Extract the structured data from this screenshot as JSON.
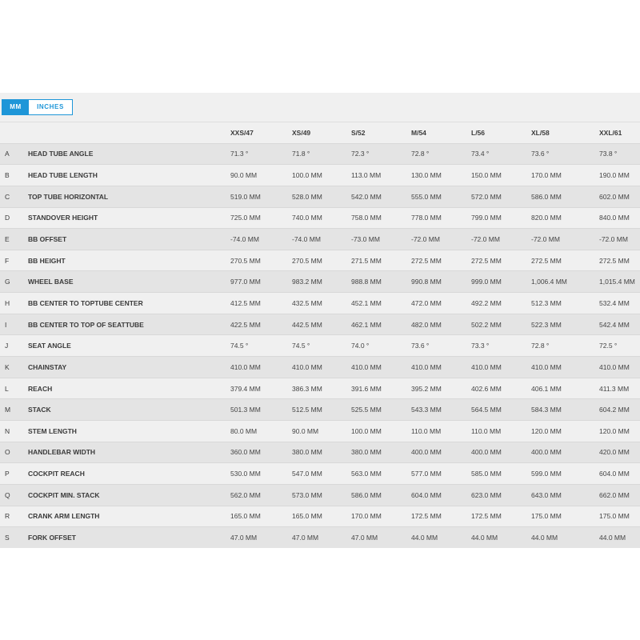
{
  "units": {
    "mm_label": "MM",
    "inches_label": "INCHES",
    "active": "mm"
  },
  "sizes": [
    "XXS/47",
    "XS/49",
    "S/52",
    "M/54",
    "L/56",
    "XL/58",
    "XXL/61"
  ],
  "rows": [
    {
      "letter": "A",
      "name": "HEAD TUBE ANGLE",
      "values": [
        "71.3 °",
        "71.8 °",
        "72.3 °",
        "72.8 °",
        "73.4 °",
        "73.6 °",
        "73.8 °"
      ]
    },
    {
      "letter": "B",
      "name": "HEAD TUBE LENGTH",
      "values": [
        "90.0 MM",
        "100.0 MM",
        "113.0 MM",
        "130.0 MM",
        "150.0 MM",
        "170.0 MM",
        "190.0 MM"
      ]
    },
    {
      "letter": "C",
      "name": "TOP TUBE HORIZONTAL",
      "values": [
        "519.0 MM",
        "528.0 MM",
        "542.0 MM",
        "555.0 MM",
        "572.0 MM",
        "586.0 MM",
        "602.0 MM"
      ]
    },
    {
      "letter": "D",
      "name": "STANDOVER HEIGHT",
      "values": [
        "725.0 MM",
        "740.0 MM",
        "758.0 MM",
        "778.0 MM",
        "799.0 MM",
        "820.0 MM",
        "840.0 MM"
      ]
    },
    {
      "letter": "E",
      "name": "BB OFFSET",
      "values": [
        "-74.0 MM",
        "-74.0 MM",
        "-73.0 MM",
        "-72.0 MM",
        "-72.0 MM",
        "-72.0 MM",
        "-72.0 MM"
      ]
    },
    {
      "letter": "F",
      "name": "BB HEIGHT",
      "values": [
        "270.5 MM",
        "270.5 MM",
        "271.5 MM",
        "272.5 MM",
        "272.5 MM",
        "272.5 MM",
        "272.5 MM"
      ]
    },
    {
      "letter": "G",
      "name": "WHEEL BASE",
      "values": [
        "977.0 MM",
        "983.2 MM",
        "988.8 MM",
        "990.8 MM",
        "999.0 MM",
        "1,006.4 MM",
        "1,015.4 MM"
      ]
    },
    {
      "letter": "H",
      "name": "BB CENTER TO TOPTUBE CENTER",
      "values": [
        "412.5 MM",
        "432.5 MM",
        "452.1 MM",
        "472.0 MM",
        "492.2 MM",
        "512.3 MM",
        "532.4 MM"
      ]
    },
    {
      "letter": "I",
      "name": "BB CENTER TO TOP OF SEATTUBE",
      "values": [
        "422.5 MM",
        "442.5 MM",
        "462.1 MM",
        "482.0 MM",
        "502.2 MM",
        "522.3 MM",
        "542.4 MM"
      ]
    },
    {
      "letter": "J",
      "name": "SEAT ANGLE",
      "values": [
        "74.5 °",
        "74.5 °",
        "74.0 °",
        "73.6 °",
        "73.3 °",
        "72.8 °",
        "72.5 °"
      ]
    },
    {
      "letter": "K",
      "name": "CHAINSTAY",
      "values": [
        "410.0 MM",
        "410.0 MM",
        "410.0 MM",
        "410.0 MM",
        "410.0 MM",
        "410.0 MM",
        "410.0 MM"
      ]
    },
    {
      "letter": "L",
      "name": "REACH",
      "values": [
        "379.4 MM",
        "386.3 MM",
        "391.6 MM",
        "395.2 MM",
        "402.6 MM",
        "406.1 MM",
        "411.3 MM"
      ]
    },
    {
      "letter": "M",
      "name": "STACK",
      "values": [
        "501.3 MM",
        "512.5 MM",
        "525.5 MM",
        "543.3 MM",
        "564.5 MM",
        "584.3 MM",
        "604.2 MM"
      ]
    },
    {
      "letter": "N",
      "name": "STEM LENGTH",
      "values": [
        "80.0 MM",
        "90.0 MM",
        "100.0 MM",
        "110.0 MM",
        "110.0 MM",
        "120.0 MM",
        "120.0 MM"
      ]
    },
    {
      "letter": "O",
      "name": "HANDLEBAR WIDTH",
      "values": [
        "360.0 MM",
        "380.0 MM",
        "380.0 MM",
        "400.0 MM",
        "400.0 MM",
        "400.0 MM",
        "420.0 MM"
      ]
    },
    {
      "letter": "P",
      "name": "COCKPIT REACH",
      "values": [
        "530.0 MM",
        "547.0 MM",
        "563.0 MM",
        "577.0 MM",
        "585.0 MM",
        "599.0 MM",
        "604.0 MM"
      ]
    },
    {
      "letter": "Q",
      "name": "COCKPIT MIN. STACK",
      "values": [
        "562.0 MM",
        "573.0 MM",
        "586.0 MM",
        "604.0 MM",
        "623.0 MM",
        "643.0 MM",
        "662.0 MM"
      ]
    },
    {
      "letter": "R",
      "name": "CRANK ARM LENGTH",
      "values": [
        "165.0 MM",
        "165.0 MM",
        "170.0 MM",
        "172.5 MM",
        "172.5 MM",
        "175.0 MM",
        "175.0 MM"
      ]
    },
    {
      "letter": "S",
      "name": "FORK OFFSET",
      "values": [
        "47.0 MM",
        "47.0 MM",
        "47.0 MM",
        "44.0 MM",
        "44.0 MM",
        "44.0 MM",
        "44.0 MM"
      ]
    }
  ]
}
